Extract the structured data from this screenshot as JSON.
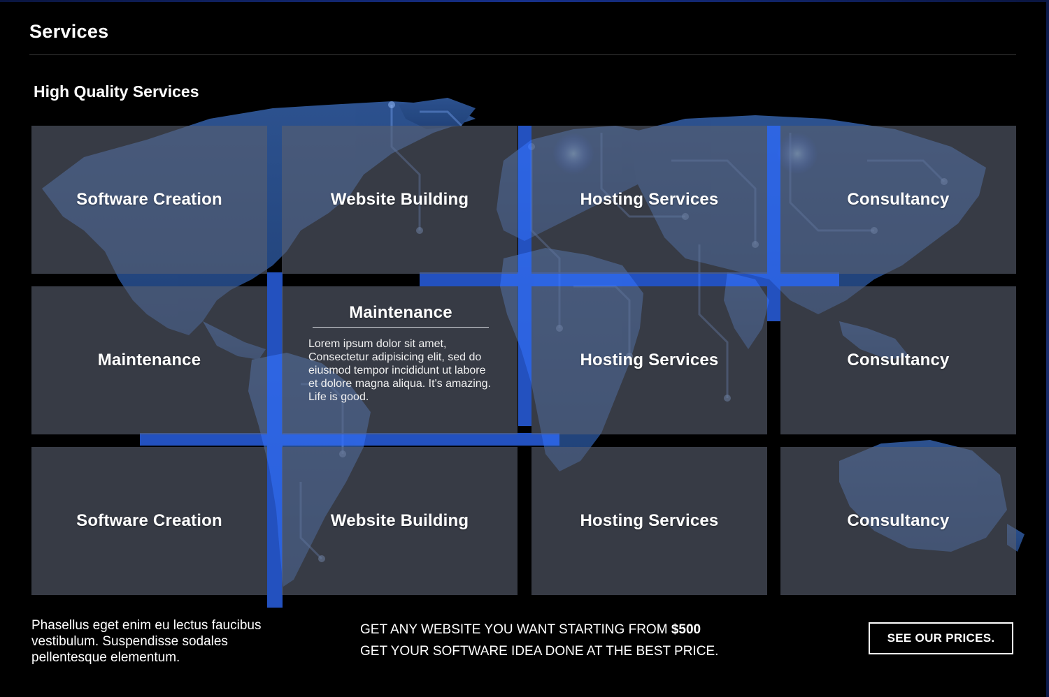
{
  "page": {
    "title": "Services",
    "section_heading": "High Quality Services"
  },
  "theme": {
    "background": "#000000",
    "tile_color": "#58606f",
    "accent_glow": "#3a7bff"
  },
  "services": {
    "row1": [
      "Software Creation",
      "Website Building",
      "Hosting Services",
      "Consultancy"
    ],
    "row2": [
      "Maintenance",
      "Maintenance",
      "Hosting Services",
      "Consultancy"
    ],
    "row3": [
      "Software Creation",
      "Website Building",
      "Hosting Services",
      "Consultancy"
    ],
    "expanded_description": "Lorem ipsum dolor sit amet, Consectetur adipisicing elit, sed do eiusmod tempor incididunt ut labore et dolore magna aliqua. It's amazing. Life is good."
  },
  "footer": {
    "text": "Phasellus eget enim eu lectus faucibus vestibulum. Suspendisse sodales pellentesque elementum.",
    "promo_line1_prefix": "GET ANY WEBSITE YOU WANT STARTING FROM ",
    "promo_line1_price": "$500",
    "promo_line2": "GET YOUR SOFTWARE IDEA DONE AT THE BEST PRICE.",
    "cta_label": "SEE OUR PRICES."
  },
  "icons": {
    "background_image": "world-map-circuit-icon"
  }
}
